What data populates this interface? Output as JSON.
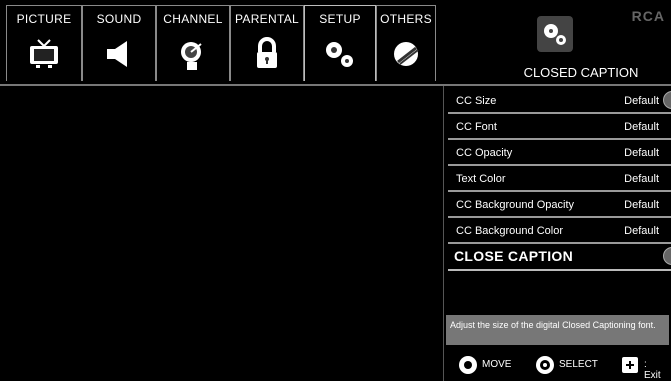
{
  "tabs": [
    {
      "label": "PICTURE",
      "icon": "tv-icon"
    },
    {
      "label": "SOUND",
      "icon": "speaker-icon"
    },
    {
      "label": "CHANNEL",
      "icon": "satellite-dish-icon"
    },
    {
      "label": "PARENTAL",
      "icon": "lock-icon"
    },
    {
      "label": "SETUP",
      "icon": "gears-icon"
    },
    {
      "label": "OTHERS",
      "icon": "others-icon"
    }
  ],
  "brand": "RCA",
  "section": {
    "title": "CLOSED CAPTION",
    "icon": "gears-icon"
  },
  "menu": {
    "items": [
      {
        "label": "CC Size",
        "value": "Default"
      },
      {
        "label": "CC Font",
        "value": "Default"
      },
      {
        "label": "CC Opacity",
        "value": "Default"
      },
      {
        "label": "Text Color",
        "value": "Default"
      },
      {
        "label": "CC Background Opacity",
        "value": "Default"
      },
      {
        "label": "CC Background Color",
        "value": "Default"
      }
    ],
    "caption_label": "CLOSE CAPTION"
  },
  "description": "Adjust the size of the digital Closed Captioning font.",
  "footer": {
    "move": "MOVE",
    "select": "SELECT",
    "exit": ": Exit"
  }
}
